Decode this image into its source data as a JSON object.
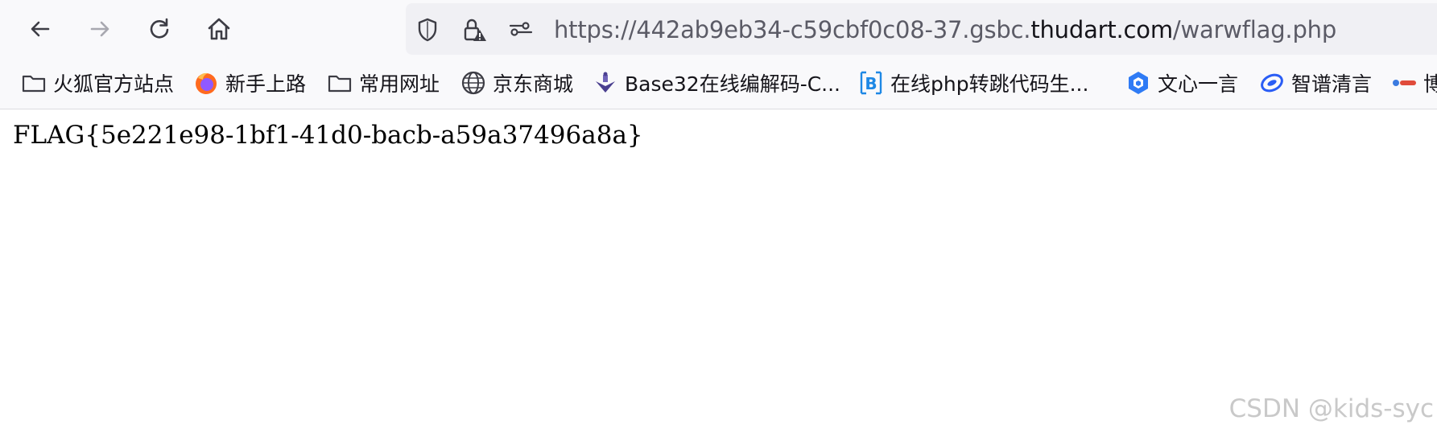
{
  "toolbar": {
    "back_icon": "arrow-left-icon",
    "forward_icon": "arrow-right-icon",
    "reload_icon": "reload-icon",
    "home_icon": "home-icon"
  },
  "urlbar": {
    "url_prefix": "https://442ab9eb34-c59cbf0c08-37.gsbc.",
    "url_domain": "thudart.com",
    "url_suffix": "/warwflag.php"
  },
  "bookmarks": [
    {
      "label": "火狐官方站点",
      "icon": "folder-icon"
    },
    {
      "label": "新手上路",
      "icon": "firefox-icon"
    },
    {
      "label": "常用网址",
      "icon": "folder-icon"
    },
    {
      "label": "京东商城",
      "icon": "globe-icon"
    },
    {
      "label": "Base32在线编解码-C...",
      "icon": "site-logo-icon"
    },
    {
      "label": "在线php转跳代码生...",
      "icon": "b-logo-icon"
    },
    {
      "label": "文心一言",
      "icon": "wenxin-icon"
    },
    {
      "label": "智谱清言",
      "icon": "zhipu-icon"
    },
    {
      "label": "博",
      "icon": "blog-icon"
    }
  ],
  "page": {
    "flag_text": "FLAG{5e221e98-1bf1-41d0-bacb-a59a37496a8a}",
    "watermark": "CSDN @kids-syc"
  },
  "colors": {
    "toolbar_bg": "#f9f9fb",
    "urlbar_bg": "#f0f0f4",
    "text_dim": "#5b5b66",
    "text_main": "#15141a"
  }
}
